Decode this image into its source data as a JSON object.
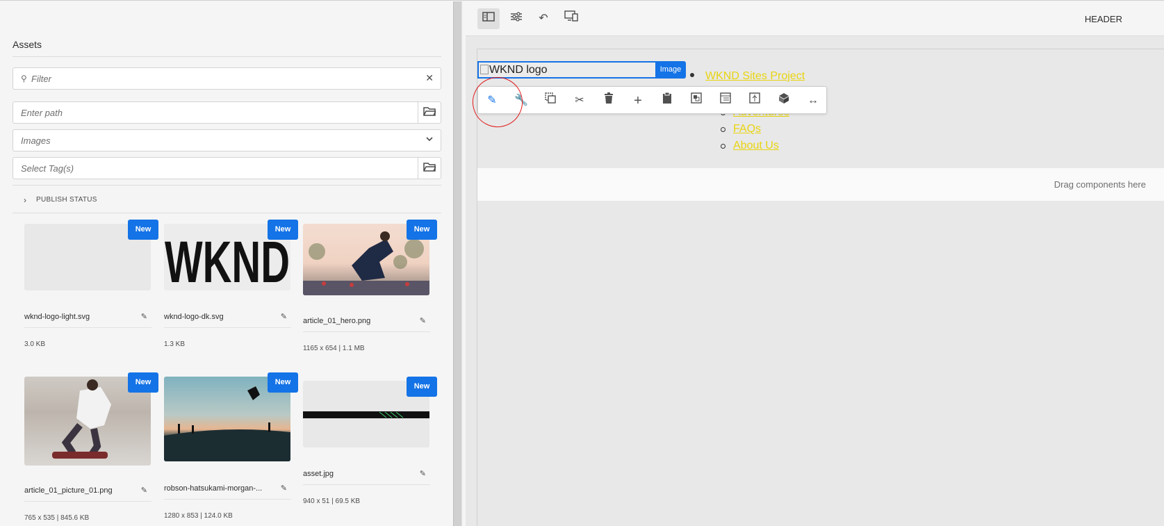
{
  "panel": {
    "title": "Assets",
    "filter_placeholder": "Filter",
    "path_placeholder": "Enter path",
    "type_select": "Images",
    "tags_placeholder": "Select Tag(s)",
    "publish_status": "PUBLISH STATUS"
  },
  "assets": [
    {
      "badge": "New",
      "name": "wknd-logo-light.svg",
      "meta": "3.0 KB"
    },
    {
      "badge": "New",
      "name": "wknd-logo-dk.svg",
      "meta": "1.3 KB",
      "logo_text": "WKND"
    },
    {
      "badge": "New",
      "name": "article_01_hero.png",
      "meta": "1165 x 654 | 1.1 MB"
    },
    {
      "badge": "New",
      "name": "article_01_picture_01.png",
      "meta": "765 x 535 | 845.6 KB"
    },
    {
      "badge": "New",
      "name": "robson-hatsukami-morgan-...",
      "meta": "1280 x 853 | 124.0 KB"
    },
    {
      "badge": "New",
      "name": "asset.jpg",
      "meta": "940 x 51 | 69.5 KB"
    }
  ],
  "editor": {
    "header_label": "HEADER",
    "logo_alt": "WKND logo",
    "component_tag": "Image",
    "nav": [
      "WKND Sites Project",
      "Adventures",
      "FAQs",
      "About Us"
    ],
    "drag_hint": "Drag components here"
  },
  "colors": {
    "accent": "#1473e6",
    "nav_link": "#e8d40f",
    "annotation": "#e01b1b"
  }
}
